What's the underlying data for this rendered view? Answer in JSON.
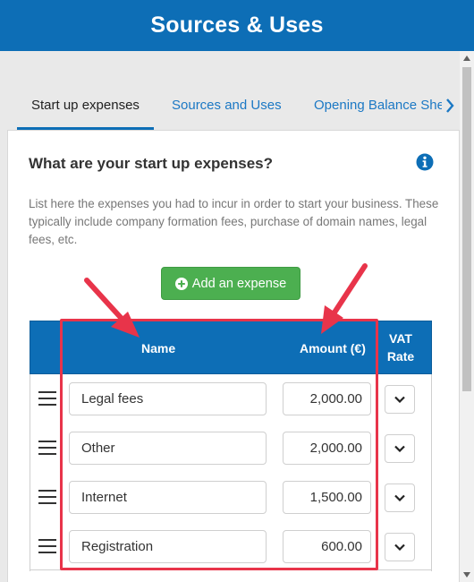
{
  "header": {
    "title": "Sources & Uses"
  },
  "tabs": [
    {
      "label": "Start up expenses"
    },
    {
      "label": "Sources and Uses"
    },
    {
      "label": "Opening Balance Sheet"
    }
  ],
  "card": {
    "title": "What are your start up expenses?",
    "description": "List here the expenses you had to incur in order to start your business. These typically include company formation fees, purchase of domain names, legal fees, etc.",
    "add_button_label": "Add an expense"
  },
  "table": {
    "headers": {
      "name": "Name",
      "amount": "Amount (€)",
      "vat_line1": "VAT",
      "vat_line2": "Rate"
    },
    "rows": [
      {
        "name": "Legal fees",
        "amount": "2,000.00"
      },
      {
        "name": "Other",
        "amount": "2,000.00"
      },
      {
        "name": "Internet",
        "amount": "1,500.00"
      },
      {
        "name": "Registration",
        "amount": "600.00"
      }
    ]
  },
  "colors": {
    "brand_blue": "#0d6eb6",
    "add_green": "#4caf50",
    "annotation_red": "#e8344a"
  },
  "icons": [
    "info-icon",
    "plus-circle-icon",
    "drag-handle-icon",
    "chevron-down-icon",
    "chevron-right-icon"
  ]
}
